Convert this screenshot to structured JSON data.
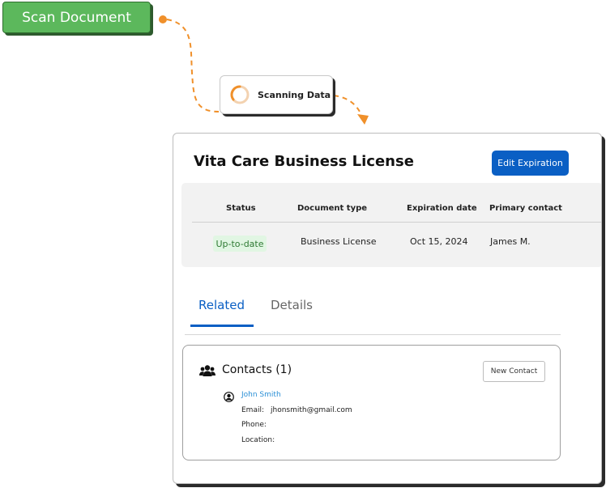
{
  "scan_button": {
    "label": "Scan Document"
  },
  "scanning_pill": {
    "label": "Scanning Data",
    "spinner_icon": "loading-spinner-icon"
  },
  "card": {
    "title": "Vita Care Business License",
    "edit_button_label": "Edit Expiration",
    "columns": [
      "Status",
      "Document type",
      "Expiration date",
      "Primary contact"
    ],
    "values": {
      "status": "Up-to-date",
      "document_type": "Business License",
      "expiration_date": "Oct 15, 2024",
      "primary_contact": "James M."
    },
    "tabs": [
      {
        "label": "Related",
        "active": true
      },
      {
        "label": "Details",
        "active": false
      }
    ],
    "contacts": {
      "title": "Contacts (1)",
      "icon": "people-icon",
      "new_button_label": "New Contact",
      "contact": {
        "name": "John Smith",
        "icon": "person-icon",
        "email_label": "Email:",
        "email_value": "jhonsmith@gmail.com",
        "phone_label": "Phone:",
        "location_label": "Location:"
      }
    }
  },
  "colors": {
    "scan_green": "#5cb85c",
    "flow_orange": "#f0902a",
    "accent_blue": "#0a5fc4",
    "status_green_bg": "#e1f6e3",
    "status_green_text": "#2f7a34",
    "link_blue": "#2a8fd6"
  }
}
